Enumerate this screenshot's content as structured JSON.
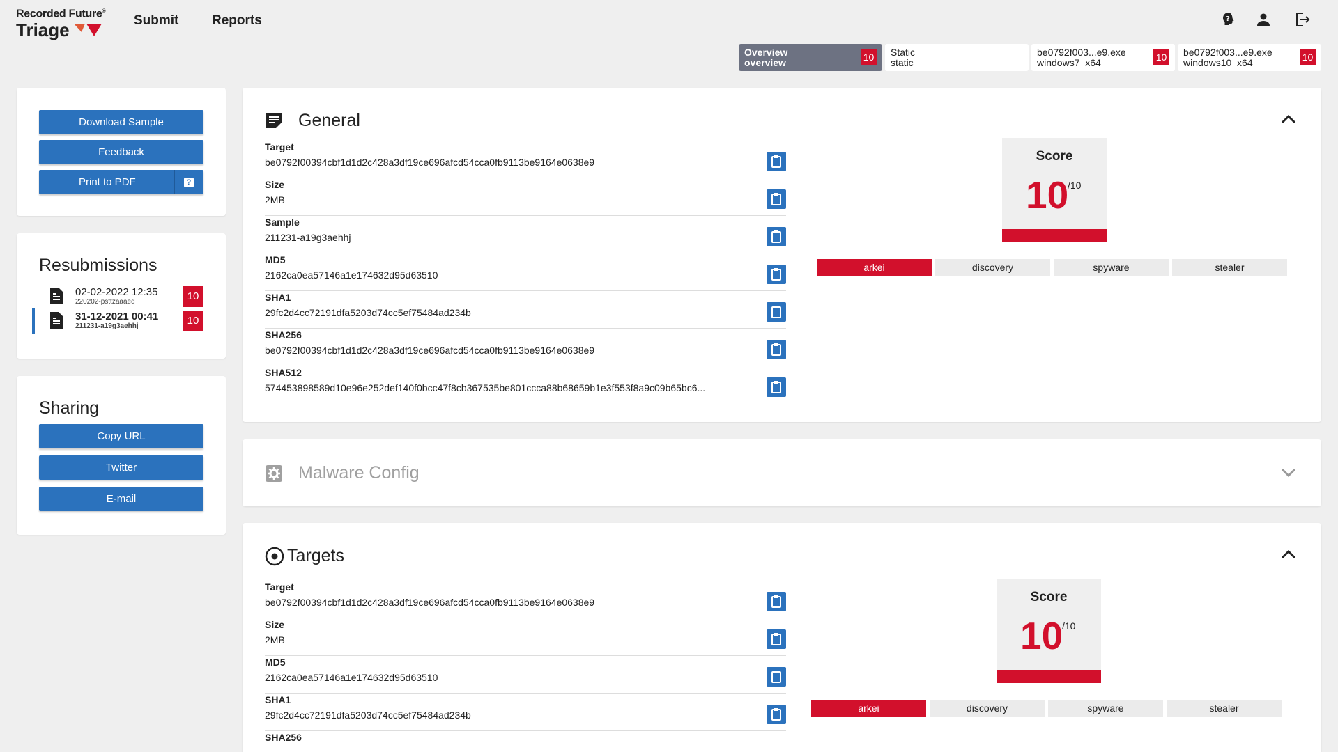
{
  "header": {
    "logo_top": "Recorded Future",
    "logo_reg": "®",
    "logo_bottom": "Triage",
    "nav": [
      "Submit",
      "Reports"
    ]
  },
  "tabs": [
    {
      "line1": "Overview",
      "line2": "overview",
      "badge": "10",
      "active": true
    },
    {
      "line1": "Static",
      "line2": "static",
      "badge": "",
      "active": false
    },
    {
      "line1": "be0792f003...e9.exe",
      "line2": "windows7_x64",
      "badge": "10",
      "active": false
    },
    {
      "line1": "be0792f003...e9.exe",
      "line2": "windows10_x64",
      "badge": "10",
      "active": false
    }
  ],
  "actions": {
    "download": "Download Sample",
    "feedback": "Feedback",
    "print": "Print to PDF",
    "print_help": "?"
  },
  "resubmissions": {
    "title": "Resubmissions",
    "items": [
      {
        "date": "02-02-2022 12:35",
        "id": "220202-psttzaaaeq",
        "score": "10"
      },
      {
        "date": "31-12-2021 00:41",
        "id": "211231-a19g3aehhj",
        "score": "10"
      }
    ]
  },
  "sharing": {
    "title": "Sharing",
    "buttons": [
      "Copy URL",
      "Twitter",
      "E-mail"
    ]
  },
  "general": {
    "title": "General",
    "fields": [
      {
        "label": "Target",
        "value": "be0792f00394cbf1d1d2c428a3df19ce696afcd54cca0fb9113be9164e0638e9"
      },
      {
        "label": "Size",
        "value": "2MB"
      },
      {
        "label": "Sample",
        "value": "211231-a19g3aehhj"
      },
      {
        "label": "MD5",
        "value": "2162ca0ea57146a1e174632d95d63510"
      },
      {
        "label": "SHA1",
        "value": "29fc2d4cc72191dfa5203d74cc5ef75484ad234b"
      },
      {
        "label": "SHA256",
        "value": "be0792f00394cbf1d1d2c428a3df19ce696afcd54cca0fb9113be9164e0638e9"
      },
      {
        "label": "SHA512",
        "value": "574453898589d10e96e252def140f0bcc47f8cb367535be801ccca88b68659b1e3f553f8a9c09b65bc6..."
      }
    ],
    "score": {
      "title": "Score",
      "value": "10",
      "max": "/10"
    },
    "tags": [
      "arkei",
      "discovery",
      "spyware",
      "stealer"
    ]
  },
  "malware_config": {
    "title": "Malware Config"
  },
  "targets": {
    "title": "Targets",
    "fields": [
      {
        "label": "Target",
        "value": "be0792f00394cbf1d1d2c428a3df19ce696afcd54cca0fb9113be9164e0638e9"
      },
      {
        "label": "Size",
        "value": "2MB"
      },
      {
        "label": "MD5",
        "value": "2162ca0ea57146a1e174632d95d63510"
      },
      {
        "label": "SHA1",
        "value": "29fc2d4cc72191dfa5203d74cc5ef75484ad234b"
      },
      {
        "label": "SHA256",
        "value": ""
      }
    ],
    "score": {
      "title": "Score",
      "value": "10",
      "max": "/10"
    },
    "tags": [
      "arkei",
      "discovery",
      "spyware",
      "stealer"
    ]
  },
  "colors": {
    "accent": "#2b72bd",
    "danger": "#d2102c",
    "tab_active": "#6d7282"
  }
}
